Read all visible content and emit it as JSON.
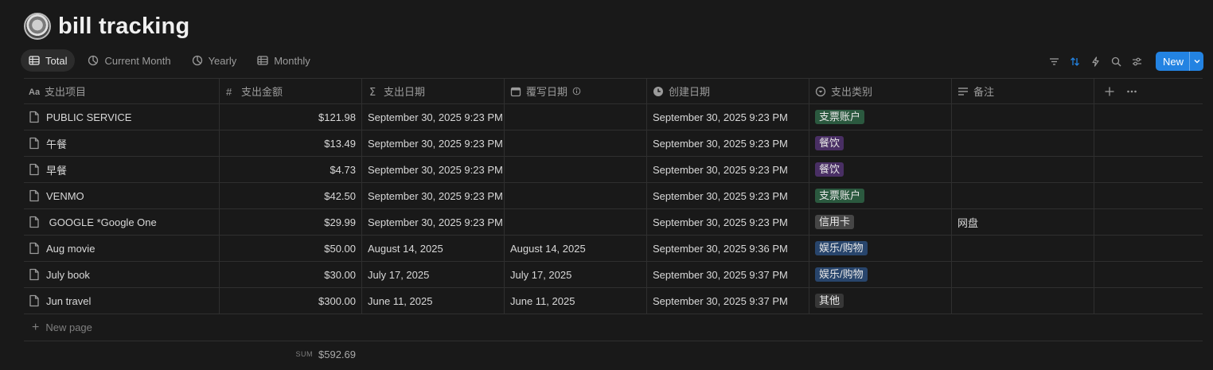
{
  "page": {
    "title": "bill tracking",
    "icon": "coin-emblem-icon"
  },
  "views": [
    {
      "label": "Total",
      "icon": "table-icon",
      "active": true
    },
    {
      "label": "Current Month",
      "icon": "chart-pie-icon",
      "active": false
    },
    {
      "label": "Yearly",
      "icon": "chart-pie-icon",
      "active": false
    },
    {
      "label": "Monthly",
      "icon": "table-icon",
      "active": false
    }
  ],
  "toolbar": {
    "icons": [
      "filter-icon",
      "sort-icon",
      "automation-icon",
      "search-icon",
      "settings-icon"
    ],
    "new_label": "New",
    "accent": "#2383e2"
  },
  "columns": [
    {
      "label": "支出项目",
      "icon": "text-icon"
    },
    {
      "label": "支出金额",
      "icon": "number-icon"
    },
    {
      "label": "支出日期",
      "icon": "formula-icon"
    },
    {
      "label": "覆写日期",
      "icon": "calendar-icon"
    },
    {
      "label": "创建日期",
      "icon": "clock-icon"
    },
    {
      "label": "支出类别",
      "icon": "select-icon"
    },
    {
      "label": "备注",
      "icon": "text-lines-icon"
    }
  ],
  "rows": [
    {
      "name": "PUBLIC SERVICE",
      "amount": "$121.98",
      "date": "September 30, 2025 9:23 PM",
      "override": "",
      "created": "September 30, 2025 9:23 PM",
      "category": "支票账户",
      "note": ""
    },
    {
      "name": "午餐",
      "amount": "$13.49",
      "date": "September 30, 2025 9:23 PM",
      "override": "",
      "created": "September 30, 2025 9:23 PM",
      "category": "餐饮",
      "note": ""
    },
    {
      "name": "早餐",
      "amount": "$4.73",
      "date": "September 30, 2025 9:23 PM",
      "override": "",
      "created": "September 30, 2025 9:23 PM",
      "category": "餐饮",
      "note": ""
    },
    {
      "name": "VENMO",
      "amount": "$42.50",
      "date": "September 30, 2025 9:23 PM",
      "override": "",
      "created": "September 30, 2025 9:23 PM",
      "category": "支票账户",
      "note": ""
    },
    {
      "name": " GOOGLE *Google One",
      "amount": "$29.99",
      "date": "September 30, 2025 9:23 PM",
      "override": "",
      "created": "September 30, 2025 9:23 PM",
      "category": "信用卡",
      "note": "网盘"
    },
    {
      "name": "Aug movie",
      "amount": "$50.00",
      "date": "August 14, 2025",
      "override": "August 14, 2025",
      "created": "September 30, 2025 9:36 PM",
      "category": "娱乐/购物",
      "note": ""
    },
    {
      "name": "July book",
      "amount": "$30.00",
      "date": "July 17, 2025",
      "override": "July 17, 2025",
      "created": "September 30, 2025 9:37 PM",
      "category": "娱乐/购物",
      "note": ""
    },
    {
      "name": "Jun travel",
      "amount": "$300.00",
      "date": "June 11, 2025",
      "override": "June 11, 2025",
      "created": "September 30, 2025 9:37 PM",
      "category": "其他",
      "note": ""
    }
  ],
  "category_colors": {
    "支票账户": "#2b593f",
    "餐饮": "#492f64",
    "信用卡": "#464646",
    "娱乐/购物": "#28456c",
    "其他": "#373737"
  },
  "footer": {
    "new_page_label": "New page",
    "sum_label": "SUM",
    "sum_value": "$592.69"
  }
}
